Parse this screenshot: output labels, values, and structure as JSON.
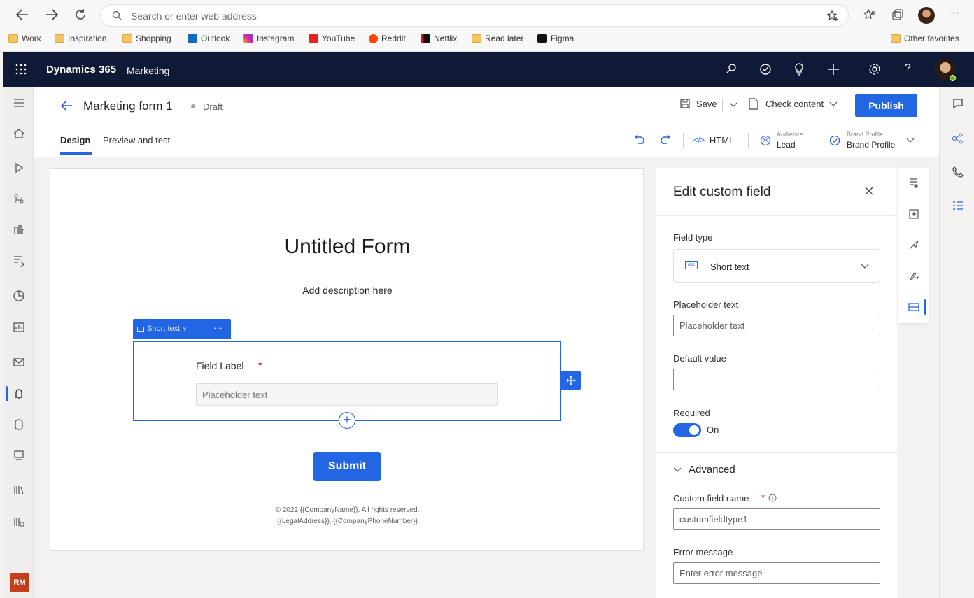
{
  "browser": {
    "address_placeholder": "Search or enter web address",
    "bookmarks": [
      "Work",
      "Inspiration",
      "Shopping",
      "Outlook",
      "Instagram",
      "YouTube",
      "Reddit",
      "Netflix",
      "Read later",
      "Figma"
    ],
    "other_favorites": "Other favorites"
  },
  "app": {
    "product": "Dynamics 365",
    "module": "Marketing",
    "user_initials": "RM"
  },
  "command": {
    "title": "Marketing form 1",
    "status": "Draft",
    "save": "Save",
    "check_content": "Check content",
    "publish": "Publish"
  },
  "tabs": {
    "design": "Design",
    "preview": "Preview and test"
  },
  "toolbar": {
    "html": "HTML",
    "audience_caption": "Audience",
    "audience_value": "Lead",
    "brand_caption": "Brand Profile",
    "brand_value": "Brand Profile"
  },
  "form": {
    "title": "Untitled Form",
    "description": "Add description here",
    "field_chip": "Short text",
    "field_label": "Field Label",
    "required_mark": "*",
    "field_placeholder": "Placeholder text",
    "submit": "Submit",
    "footer_line1": "© 2022 {{CompanyName}}. All rights reserved.",
    "footer_line2": "{{LegalAddress}}, {{CompanyPhoneNumber}}"
  },
  "panel": {
    "title": "Edit custom field",
    "field_type_label": "Field type",
    "field_type_value": "Short text",
    "placeholder_label": "Placeholder text",
    "placeholder_value": "Placeholder text",
    "default_label": "Default value",
    "default_value": "",
    "required_label": "Required",
    "required_state": "On",
    "advanced": "Advanced",
    "custom_name_label": "Custom field name",
    "custom_name_value": "customfieldtype1",
    "error_label": "Error message",
    "error_placeholder": "Enter error message"
  },
  "colors": {
    "accent": "#2266e3",
    "header": "#0f1b36",
    "avatar_badge": "#c43e1c"
  }
}
